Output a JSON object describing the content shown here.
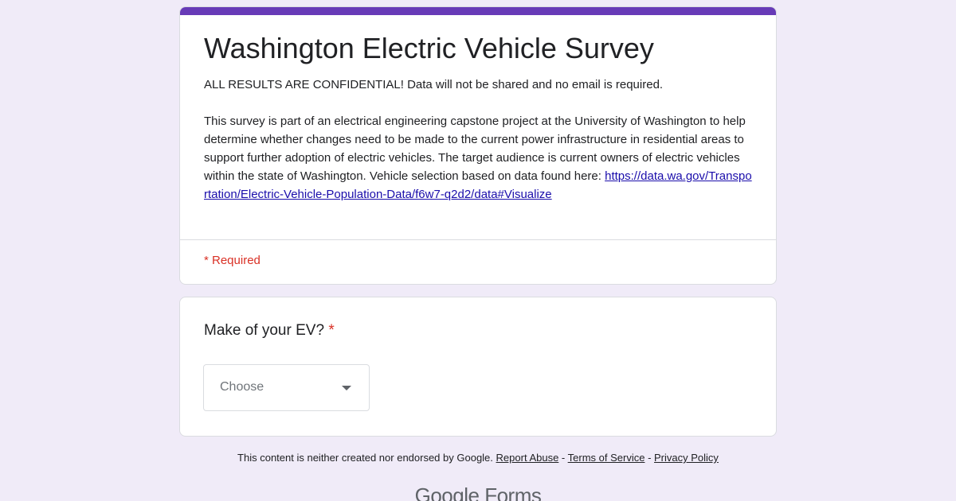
{
  "form": {
    "title": "Washington Electric Vehicle Survey",
    "description_lead": "ALL RESULTS ARE CONFIDENTIAL! Data will not be shared and no email is required.\n\nThis survey is part of an electrical engineering capstone project at the University of Washington to help determine whether changes need to be made to the current power infrastructure in residential areas to support further adoption of electric vehicles. The target audience is current owners of electric vehicles within the state of Washington. Vehicle selection based on data found here: ",
    "description_link": "https://data.wa.gov/Transportation/Electric-Vehicle-Population-Data/f6w7-q2d2/data#Visualize",
    "required_note": "* Required",
    "accent_color": "#673ab7"
  },
  "question": {
    "title": "Make of your EV?",
    "required_star": "*",
    "dropdown_value": "Choose",
    "dropdown_icon": "caret-down-icon"
  },
  "footer": {
    "disclaimer": "This content is neither created nor endorsed by Google.",
    "link_report": "Report Abuse",
    "sep1": " - ",
    "link_terms": "Terms of Service",
    "sep2": " - ",
    "link_privacy": "Privacy Policy",
    "brand_google": "Google",
    "brand_forms": "Forms"
  }
}
